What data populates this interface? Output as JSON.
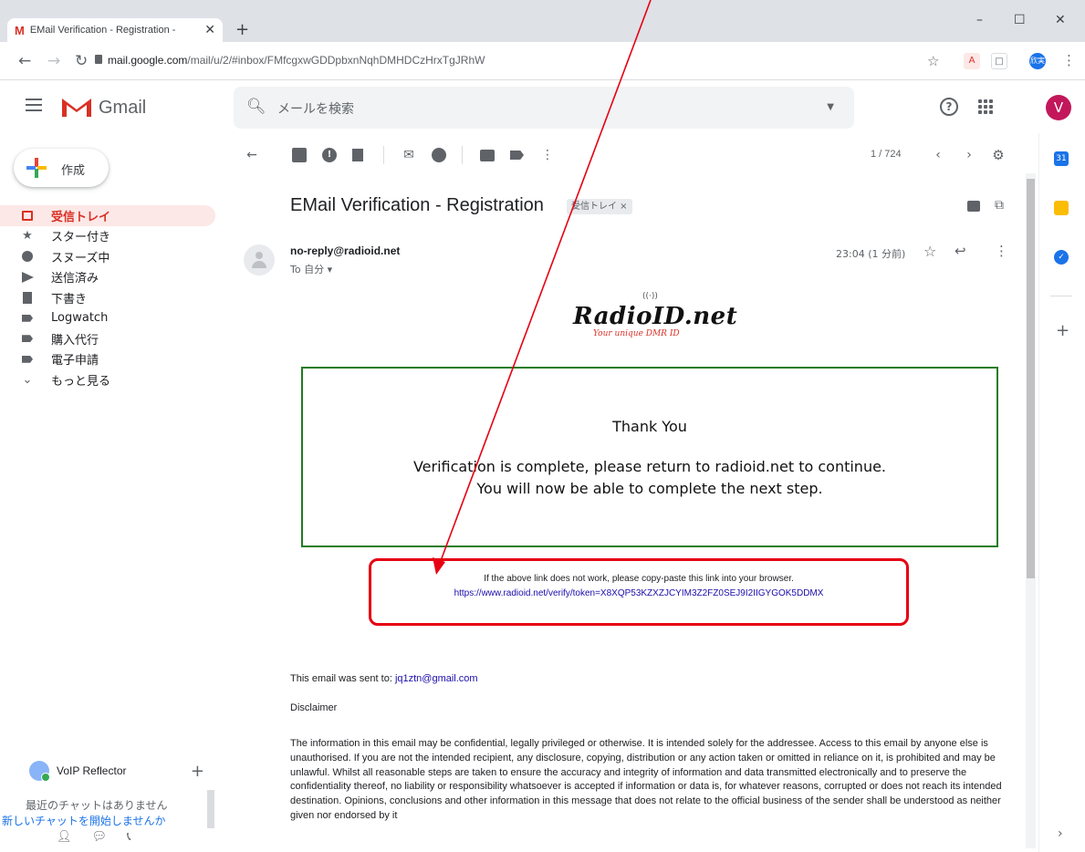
{
  "browser": {
    "tab_title": "EMail Verification - Registration -",
    "tab_icon_letter": "M",
    "url_domain": "mail.google.com",
    "url_path": "/mail/u/2/#inbox/FMfcgxwGDDpbxnNqhDMHDCzHrxTgJRhW",
    "profile_badge": "欣実"
  },
  "gmail": {
    "logo_text": "Gmail",
    "search_placeholder": "メールを検索",
    "avatar_letter": "V",
    "help_glyph": "?"
  },
  "sidebar": {
    "compose_label": "作成",
    "items": [
      {
        "label": "受信トレイ",
        "icon": "inbox-icon",
        "active": true
      },
      {
        "label": "スター付き",
        "icon": "star-icon"
      },
      {
        "label": "スヌーズ中",
        "icon": "clock-icon"
      },
      {
        "label": "送信済み",
        "icon": "send-icon"
      },
      {
        "label": "下書き",
        "icon": "draft-icon"
      },
      {
        "label": "Logwatch",
        "icon": "label-icon"
      },
      {
        "label": "購入代行",
        "icon": "label-icon"
      },
      {
        "label": "電子申請",
        "icon": "label-icon"
      },
      {
        "label": "もっと見る",
        "icon": "chevron-down-icon"
      }
    ],
    "chat": {
      "user_name": "VoIP Reflector",
      "empty_text": "最近のチャットはありません",
      "start_link": "新しいチャットを開始しませんか"
    }
  },
  "toolbar": {
    "pager": "1 / 724"
  },
  "email": {
    "subject": "EMail Verification - Registration",
    "label_chip": "受信トレイ ×",
    "sender": "no-reply@radioid.net",
    "to": "To 自分 ▾",
    "time": "23:04 (1 分前)",
    "brand_name": "RadioID.net",
    "brand_tagline": "Your unique DMR ID",
    "brand_waves": "((·))",
    "box_line1": "Thank You",
    "box_line2": "Verification is complete, please return to radioid.net to continue.",
    "box_line3": "You will now be able to complete the next step.",
    "link_hint": "If the above link does not work, please copy-paste this link into your browser.",
    "link_url": "https://www.radioid.net/verify/token=X8XQP53KZXZJCYIM3Z2FZ0SEJ9I2IIGYGOK5DDMX",
    "sent_to_label": "This email was sent to: ",
    "sent_to_email": "jq1ztn@gmail.com",
    "disclaimer_heading": "Disclaimer",
    "disclaimer_body": "The information in this email may be confidential, legally privileged or otherwise. It is intended solely for the addressee. Access to this email by anyone else is unauthorised. If you are not the intended recipient, any disclosure, copying, distribution or any action taken or omitted in reliance on it, is prohibited and may be unlawful. Whilst all reasonable steps are taken to ensure the accuracy and integrity of information and data transmitted electronically and to preserve the confidentiality thereof, no liability or responsibility whatsoever is accepted if information or data is, for whatever reasons, corrupted or does not reach its intended destination. Opinions, conclusions and other information in this message that does not relate to the official business of the sender shall be understood as neither given nor endorsed by it"
  },
  "rail": {
    "calendar_label": "31"
  },
  "colors": {
    "annotation_red": "#e60012",
    "verify_border": "#1e7d1e",
    "gmail_red": "#d93025",
    "link_blue": "#1a0dab"
  }
}
